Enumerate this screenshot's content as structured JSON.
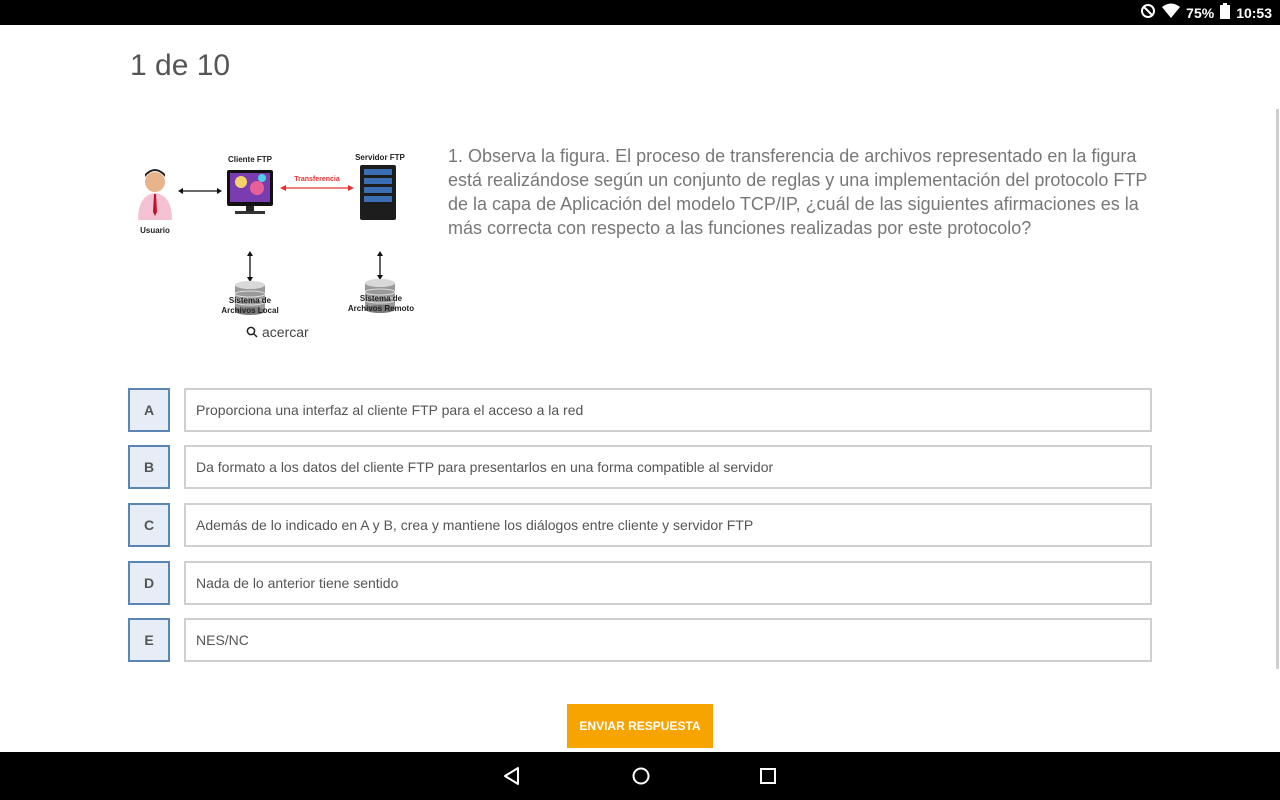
{
  "status_bar": {
    "battery_percent": "75%",
    "time": "10:53",
    "icons": [
      "do-not-disturb-icon",
      "wifi-icon",
      "battery-icon"
    ]
  },
  "quiz": {
    "progress": "1 de 10",
    "zoom_label": "acercar",
    "question": "1. Observa la figura. El proceso de transferencia de archivos representado en la figura está realizándose según un conjunto de reglas y una implementación del protocolo FTP de la capa de Aplicación del modelo TCP/IP, ¿cuál de las siguientes afirmaciones es la más correcta con respecto a las funciones realizadas por este protocolo?",
    "figure": {
      "client_label": "Cliente FTP",
      "server_label": "Servidor FTP",
      "transfer_label": "Transferencia",
      "user_label": "Usuario",
      "local_fs_label_1": "Sistema de",
      "local_fs_label_2": "Archivos Local",
      "remote_fs_label_1": "Sistema de",
      "remote_fs_label_2": "Archivos Remoto"
    },
    "options": [
      {
        "letter": "A",
        "text": "Proporciona una interfaz al cliente FTP para el acceso a la red"
      },
      {
        "letter": "B",
        "text": "Da formato a los datos del cliente FTP para presentarlos en una forma compatible al servidor"
      },
      {
        "letter": "C",
        "text": "Además de lo indicado en A y B, crea y mantiene los diálogos entre cliente y servidor FTP"
      },
      {
        "letter": "D",
        "text": "Nada de lo anterior tiene sentido"
      },
      {
        "letter": "E",
        "text": "NES/NC"
      }
    ],
    "submit_label": "ENVIAR RESPUESTA"
  },
  "colors": {
    "accent": "#f7a400",
    "option_border": "#5b86b3",
    "option_bg": "#e6edf6"
  },
  "nav": {
    "icons": [
      "back-icon",
      "home-icon",
      "recents-icon"
    ]
  }
}
